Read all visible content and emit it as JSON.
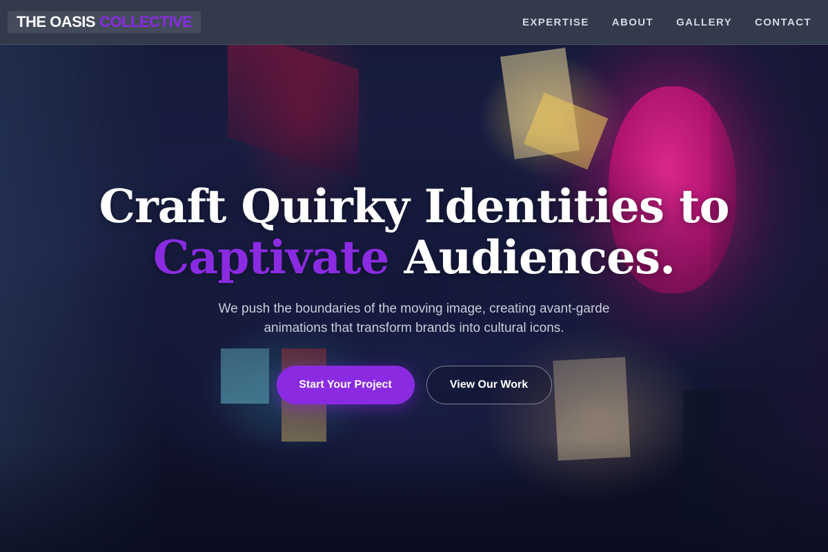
{
  "brand": {
    "name_main": "THE OASIS",
    "name_accent": "COLLECTIVE",
    "accent_color": "#8a2be2"
  },
  "nav": {
    "items": [
      {
        "label": "EXPERTISE"
      },
      {
        "label": "ABOUT"
      },
      {
        "label": "GALLERY"
      },
      {
        "label": "CONTACT"
      }
    ]
  },
  "hero": {
    "headline_line1": "Craft Quirky Identities to",
    "headline_highlight": "Captivate",
    "headline_rest": "Audiences.",
    "subtitle_line1": "We push the boundaries of the moving image, creating avant-garde",
    "subtitle_line2": "animations that transform brands into cultural icons.",
    "primary_cta": "Start Your Project",
    "secondary_cta": "View Our Work"
  },
  "colors": {
    "header_bg": "#323a4b",
    "primary": "#8a2be2",
    "text": "#ffffff"
  }
}
